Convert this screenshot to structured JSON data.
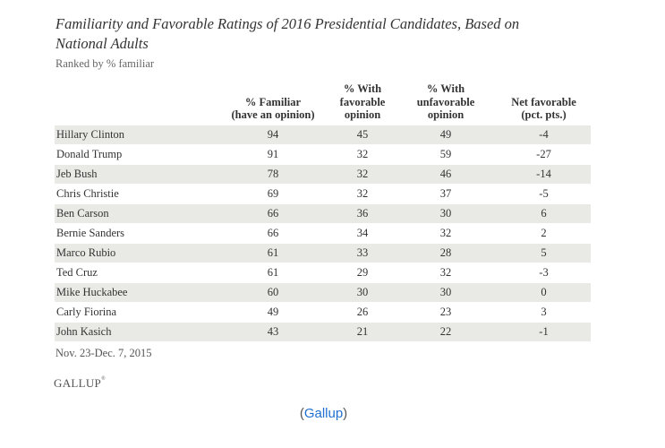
{
  "title": "Familiarity and Favorable Ratings of 2016 Presidential Candidates, Based on National Adults",
  "subtitle": "Ranked by % familiar",
  "table": {
    "headers": [
      "",
      "% Familiar (have an opinion)",
      "% With favorable opinion",
      "% With unfavorable opinion",
      "Net favorable (pct. pts.)"
    ],
    "header_lines": {
      "familiar": [
        "% Familiar",
        "(have an opinion)"
      ],
      "favorable": [
        "% With",
        "favorable",
        "opinion"
      ],
      "unfavorable": [
        "% With",
        "unfavorable",
        "opinion"
      ],
      "net": [
        "Net favorable",
        "(pct. pts.)"
      ]
    },
    "rows": [
      {
        "name": "Hillary Clinton",
        "familiar": "94",
        "favorable": "45",
        "unfavorable": "49",
        "net": "-4"
      },
      {
        "name": "Donald Trump",
        "familiar": "91",
        "favorable": "32",
        "unfavorable": "59",
        "net": "-27"
      },
      {
        "name": "Jeb Bush",
        "familiar": "78",
        "favorable": "32",
        "unfavorable": "46",
        "net": "-14"
      },
      {
        "name": "Chris Christie",
        "familiar": "69",
        "favorable": "32",
        "unfavorable": "37",
        "net": "-5"
      },
      {
        "name": "Ben Carson",
        "familiar": "66",
        "favorable": "36",
        "unfavorable": "30",
        "net": "6"
      },
      {
        "name": "Bernie Sanders",
        "familiar": "66",
        "favorable": "34",
        "unfavorable": "32",
        "net": "2"
      },
      {
        "name": "Marco Rubio",
        "familiar": "61",
        "favorable": "33",
        "unfavorable": "28",
        "net": "5"
      },
      {
        "name": "Ted Cruz",
        "familiar": "61",
        "favorable": "29",
        "unfavorable": "32",
        "net": "-3"
      },
      {
        "name": "Mike Huckabee",
        "familiar": "60",
        "favorable": "30",
        "unfavorable": "30",
        "net": "0"
      },
      {
        "name": "Carly Fiorina",
        "familiar": "49",
        "favorable": "26",
        "unfavorable": "23",
        "net": "3"
      },
      {
        "name": "John Kasich",
        "familiar": "43",
        "favorable": "21",
        "unfavorable": "22",
        "net": "-1"
      }
    ]
  },
  "date_range": "Nov. 23-Dec. 7, 2015",
  "logo_text": "GALLUP",
  "logo_mark": "®",
  "caption": {
    "open": "(",
    "link": "Gallup",
    "close": ")"
  },
  "colors": {
    "row_shade": "#e9e9e5",
    "link": "#1f6fd0"
  }
}
